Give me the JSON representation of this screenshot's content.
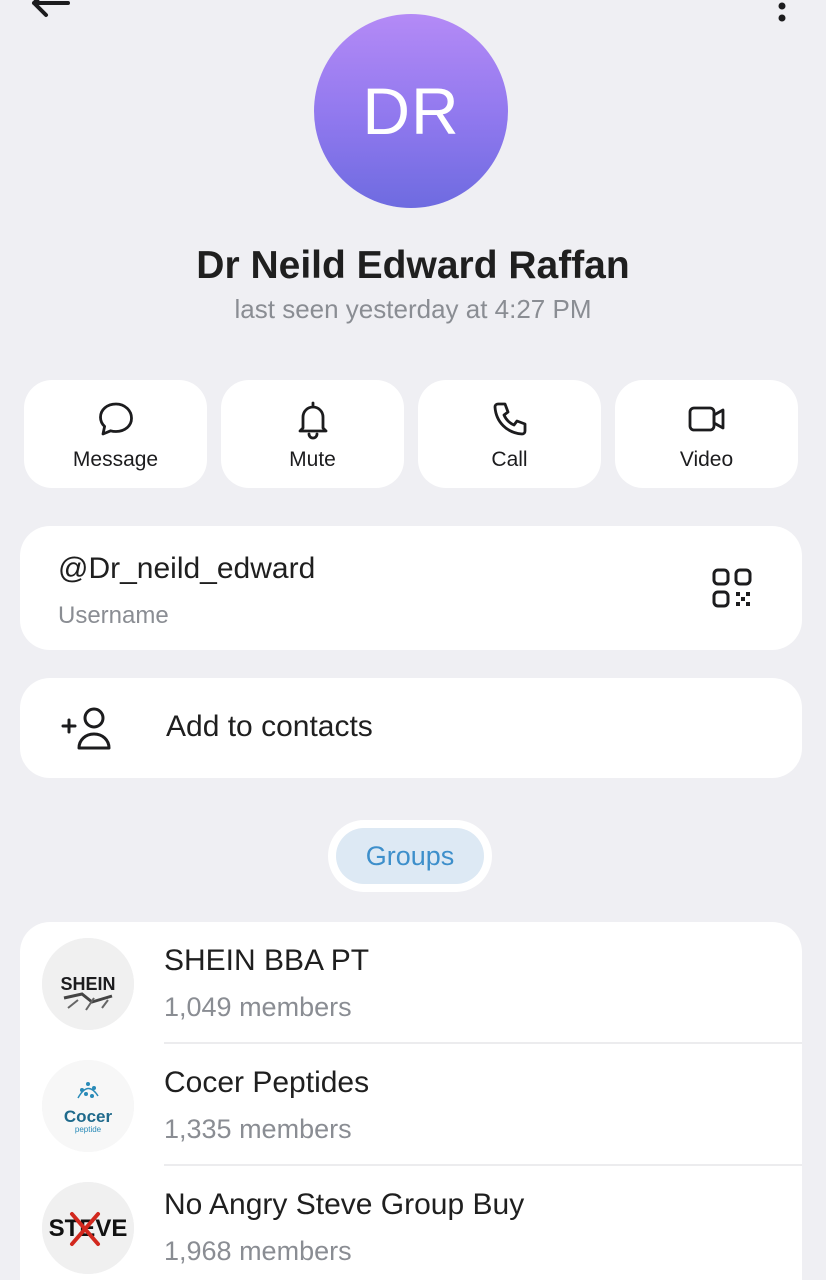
{
  "profile": {
    "avatar_initials": "DR",
    "avatar_gradient": [
      "#b48af6",
      "#6e6be0"
    ],
    "name": "Dr Neild Edward Raffan",
    "last_seen": "last seen yesterday at 4:27 PM"
  },
  "actions": [
    {
      "label": "Message",
      "icon": "chat-bubble-icon"
    },
    {
      "label": "Mute",
      "icon": "bell-icon"
    },
    {
      "label": "Call",
      "icon": "phone-icon"
    },
    {
      "label": "Video",
      "icon": "video-camera-icon"
    }
  ],
  "username": {
    "value": "@Dr_neild_edward",
    "label": "Username",
    "icon": "qr-code-icon"
  },
  "add_contact": {
    "label": "Add to contacts",
    "icon": "add-person-icon"
  },
  "groups_tab": {
    "label": "Groups",
    "accent": "#3d8fcb"
  },
  "groups": [
    {
      "name": "SHEIN BBA PT",
      "members": "1,049 members",
      "thumb_text": "SHEIN"
    },
    {
      "name": "Cocer Peptides",
      "members": "1,335 members",
      "thumb_text": "Cocer",
      "thumb_subtext": "peptide"
    },
    {
      "name": "No Angry Steve Group Buy",
      "members": "1,968 members",
      "thumb_text": "STEVE"
    }
  ]
}
